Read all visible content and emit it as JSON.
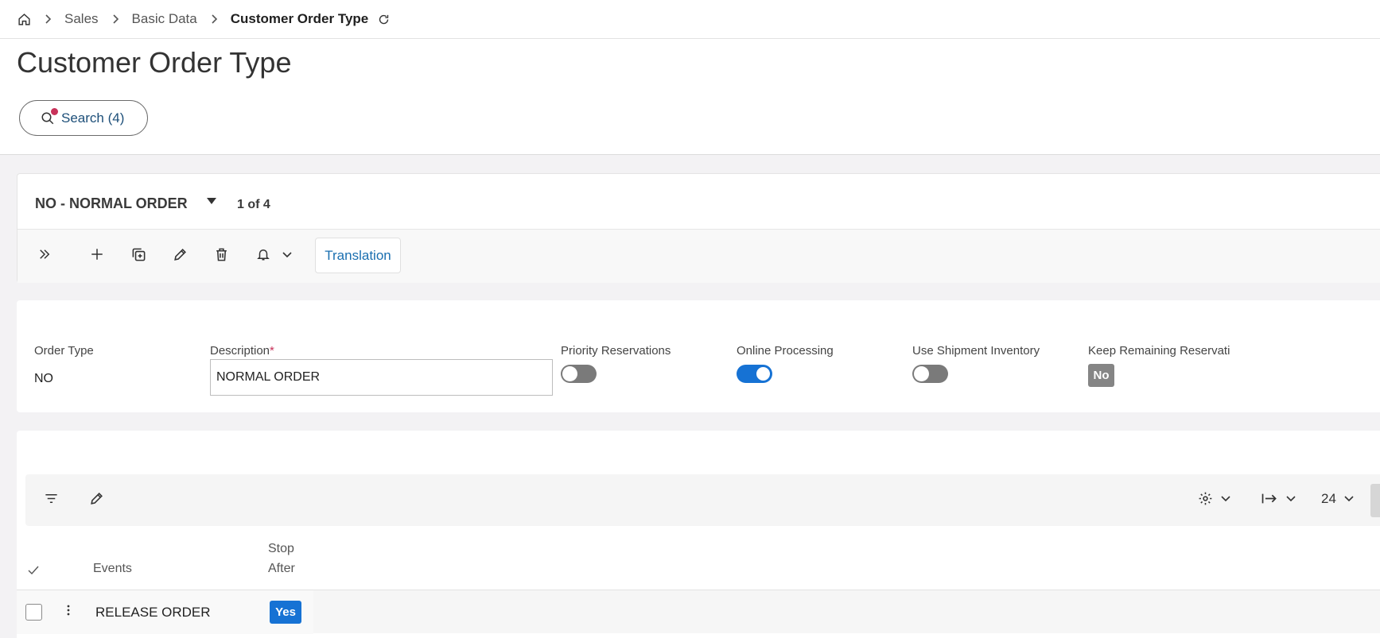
{
  "breadcrumb": {
    "items": [
      "Sales",
      "Basic Data"
    ],
    "current": "Customer Order Type"
  },
  "page": {
    "title": "Customer Order Type",
    "search_label": "Search (4)"
  },
  "record": {
    "title": "NO - NORMAL ORDER",
    "counter": "1 of 4",
    "toolbar": {
      "translation_label": "Translation"
    }
  },
  "fields": {
    "order_type": {
      "label": "Order Type",
      "value": "NO"
    },
    "description": {
      "label": "Description",
      "required_mark": "*",
      "value": "NORMAL ORDER"
    },
    "priority_reservations": {
      "label": "Priority Reservations",
      "on": false
    },
    "online_processing": {
      "label": "Online Processing",
      "on": true
    },
    "use_shipment_inventory": {
      "label": "Use Shipment Inventory",
      "on": false
    },
    "keep_remaining_reservation": {
      "label": "Keep Remaining Reservati",
      "value": "No"
    }
  },
  "table": {
    "page_size": "24",
    "columns": {
      "events": "Events",
      "stop_after_line1": "Stop",
      "stop_after_line2": "After"
    },
    "rows": [
      {
        "event": "RELEASE ORDER",
        "stop_after": "Yes"
      }
    ]
  },
  "colors": {
    "accent": "#1672d4",
    "link": "#1a6fb0",
    "notification_dot": "#c8325a",
    "badge_gray": "#858585"
  },
  "icons": [
    "home-icon",
    "chevron-right-icon",
    "refresh-icon",
    "search-icon",
    "caret-down-icon",
    "double-chevron-right-icon",
    "plus-icon",
    "duplicate-icon",
    "pencil-icon",
    "trash-icon",
    "bell-icon",
    "filter-icon",
    "gear-icon",
    "arrow-to-right-icon",
    "kebab-icon",
    "checkmark-icon"
  ]
}
